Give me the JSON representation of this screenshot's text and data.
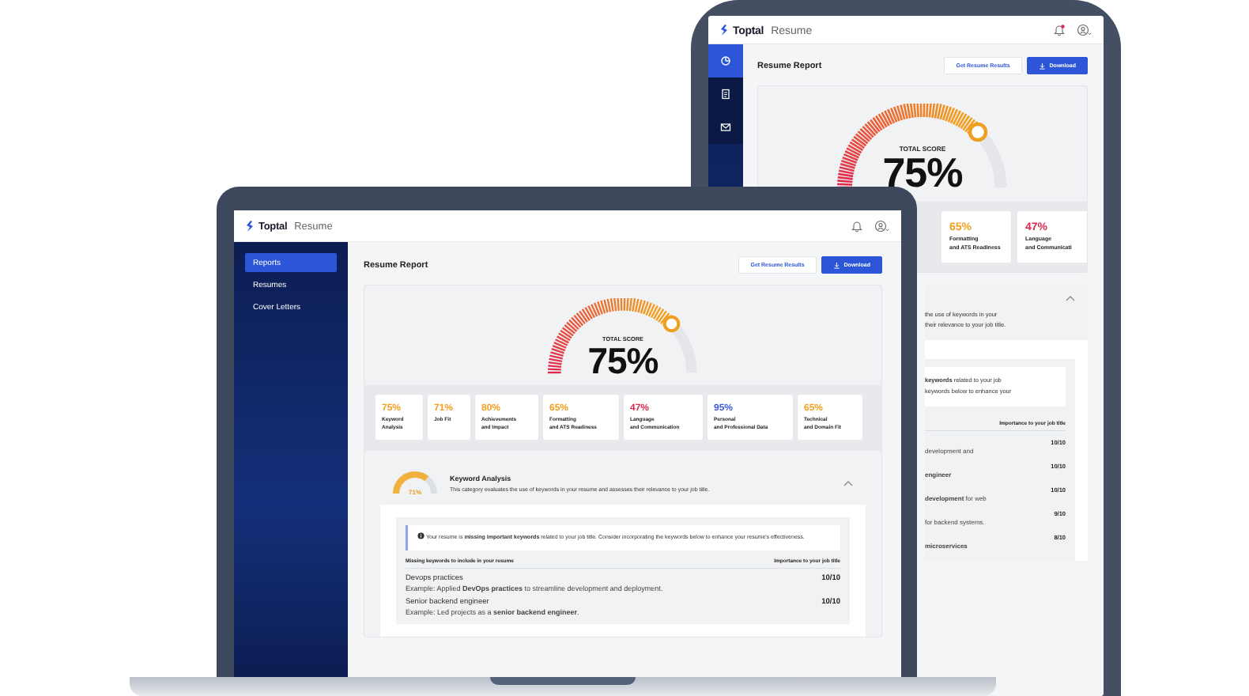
{
  "laptop": {
    "header": {
      "logo": "Toptal",
      "product": "Resume",
      "unread": false
    },
    "nav": [
      {
        "label": "Reports",
        "selected": true
      },
      {
        "label": "Resumes",
        "selected": false
      },
      {
        "label": "Cover Letters",
        "selected": false
      }
    ],
    "page_title": "Resume Report",
    "buttons": [
      {
        "label": "Get Resume Results",
        "kind": "secondary"
      },
      {
        "label": "Download",
        "kind": "primary"
      }
    ],
    "total_score": {
      "label": "TOTAL SCORE",
      "value": "75%",
      "level": 0.75
    },
    "categories": [
      {
        "value": "75%",
        "label": [
          "Keyword",
          "Analysis"
        ],
        "color": "#f0a020"
      },
      {
        "value": "71%",
        "label": [
          "Job Fit"
        ],
        "color": "#f0a020"
      },
      {
        "value": "80%",
        "label": [
          "Achievements",
          "and Impact"
        ],
        "color": "#f0a020"
      },
      {
        "value": "65%",
        "label": [
          "Formatting",
          "and ATS Readiness"
        ],
        "color": "#f0a020"
      },
      {
        "value": "47%",
        "label": [
          "Language",
          "and Communication"
        ],
        "color": "#e0284f"
      },
      {
        "value": "95%",
        "label": [
          "Personal",
          "and Professional Data"
        ],
        "color": "#3b5bdb"
      },
      {
        "value": "65%",
        "label": [
          "Technical",
          "and Domain Fit"
        ],
        "color": "#f0a020"
      }
    ],
    "keyword_analysis": {
      "title": "Keyword Analysis",
      "score": "71%",
      "level": 0.71,
      "expanded": true,
      "description": "This category evaluates the use of keywords in your resume and assesses their relevance to your job title.",
      "callout": "Your resume is **missing important keywords** related to your job title. Consider incorporating the keywords below to enhance your resume's effectiveness.",
      "columns": [
        "Missing keywords to include in your resume",
        "Importance to your job title"
      ],
      "rows": [
        {
          "keyword": "Devops practices",
          "importance": "10/10",
          "example": "Example: Applied **DevOps practices** to streamline development and deployment."
        },
        {
          "keyword": "Senior backend engineer",
          "importance": "10/10",
          "example": "Example: Led projects as a **senior backend engineer**."
        }
      ]
    }
  },
  "tablet": {
    "header": {
      "logo": "Toptal",
      "product": "Resume",
      "unread": true
    },
    "nav": [
      {
        "kind": "chart",
        "selected": true
      },
      {
        "kind": "document",
        "selected": false
      },
      {
        "kind": "mail",
        "selected": false
      }
    ],
    "page_title": "Resume Report",
    "buttons": [
      {
        "label": "Get Resume Results",
        "kind": "secondary"
      },
      {
        "label": "Download",
        "kind": "primary"
      }
    ],
    "total_score": {
      "label": "TOTAL SCORE",
      "value": "75%",
      "level": 0.75
    },
    "categories": [
      {
        "value": "65%",
        "label": [
          "Formatting",
          "and ATS Readiness"
        ],
        "color": "#f0a020"
      },
      {
        "value": "47%",
        "label": [
          "Language",
          "and Communicati"
        ],
        "color": "#e0284f"
      }
    ],
    "keyword_analysis": {
      "expanded": true,
      "description": [
        "the use of keywords in your",
        "their relevance to your job title."
      ],
      "callout": [
        "**keywords** related to your job",
        "keywords below to enhance your"
      ],
      "column": "Importance to your job title",
      "rows": [
        {
          "importance": "10/10",
          "example": "development and"
        },
        {
          "importance": "10/10",
          "example": "**engineer**"
        },
        {
          "importance": "10/10",
          "example": "**development** for web"
        },
        {
          "importance": "9/10",
          "example": "for backend systems."
        },
        {
          "importance": "8/10",
          "example": "**microservices**"
        }
      ]
    }
  }
}
